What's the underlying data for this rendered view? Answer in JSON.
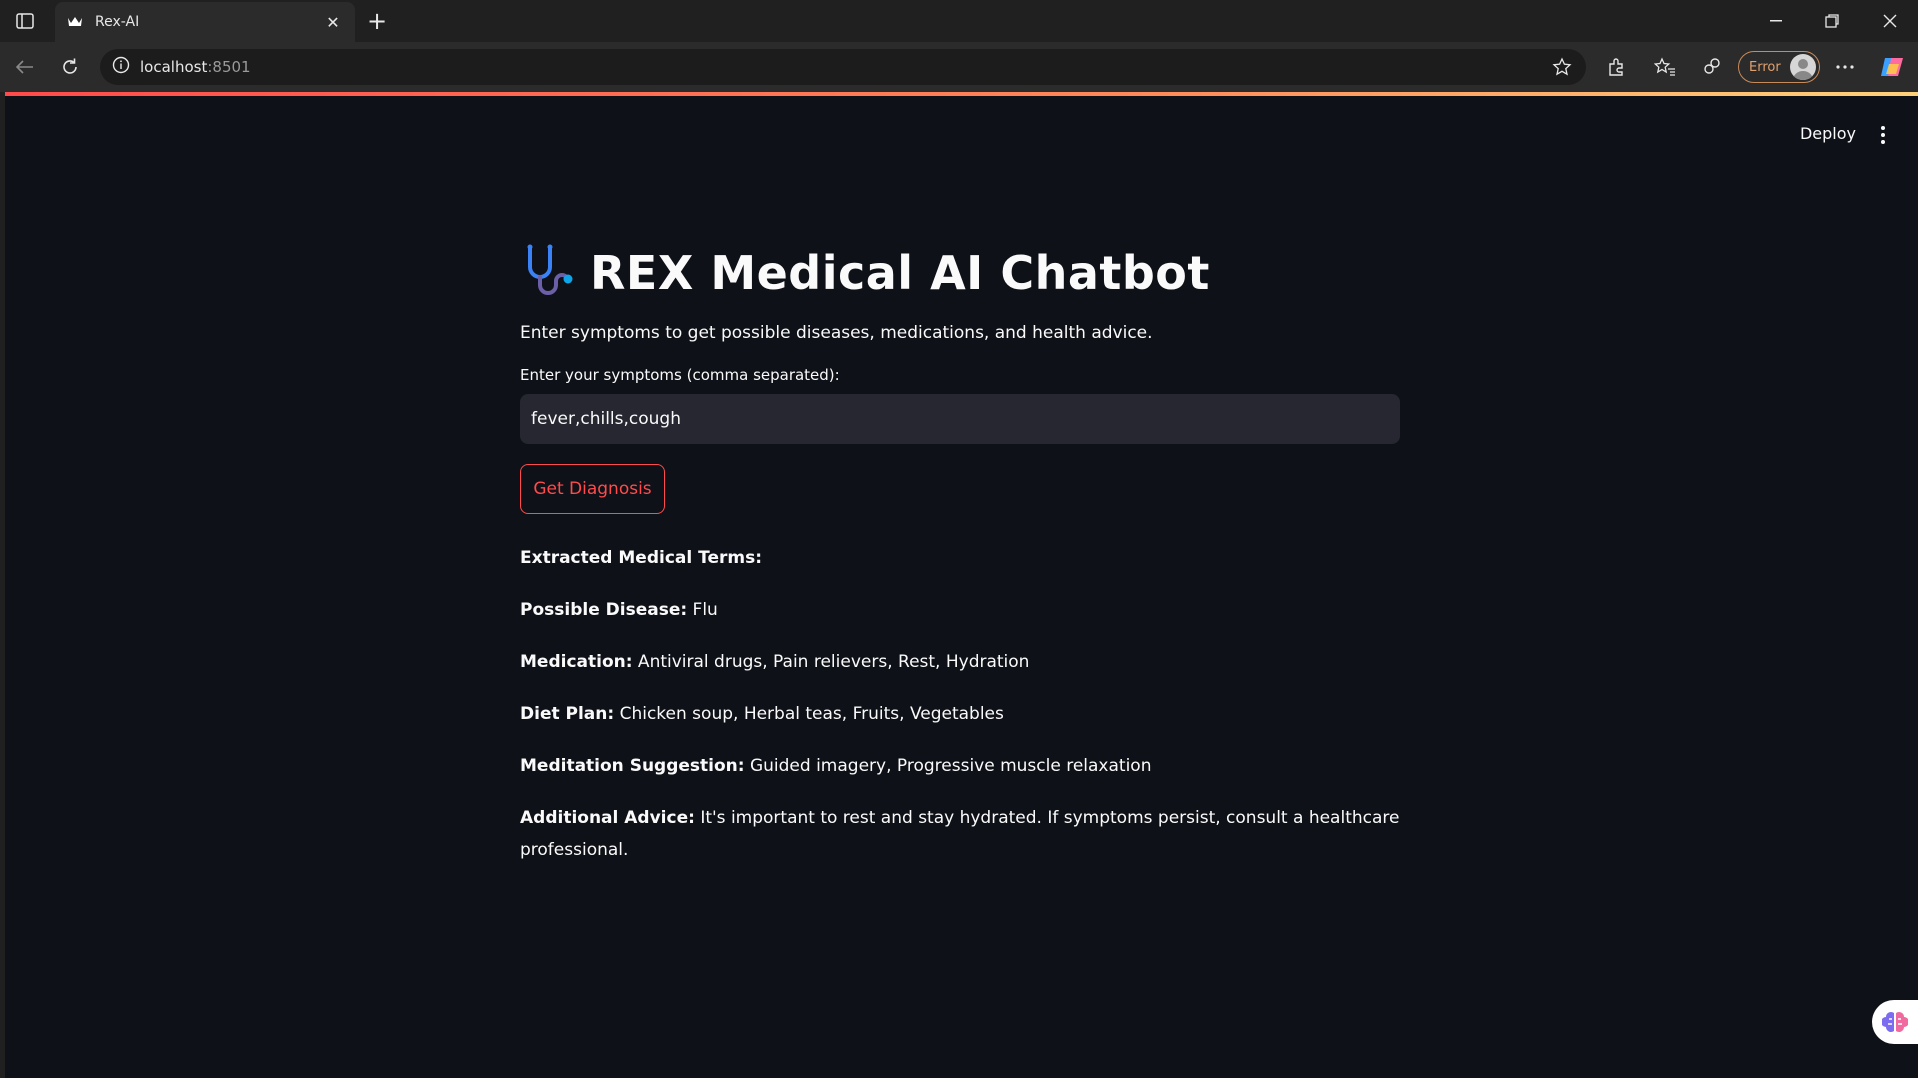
{
  "browser": {
    "tab_title": "Rex-AI",
    "tab_close": "✕",
    "new_tab": "+",
    "url_host": "localhost",
    "url_port": ":8501",
    "profile_label": "Error"
  },
  "app": {
    "deploy_label": "Deploy",
    "title": "REX Medical AI Chatbot",
    "subtitle": "Enter symptoms to get possible diseases, medications, and health advice.",
    "input_label": "Enter your symptoms (comma separated):",
    "input_value": "fever,chills,cough",
    "button_label": "Get Diagnosis",
    "results": {
      "extracted_label": "Extracted Medical Terms:",
      "disease_label": "Possible Disease:",
      "disease_value": " Flu",
      "medication_label": "Medication:",
      "medication_value": " Antiviral drugs, Pain relievers, Rest, Hydration",
      "diet_label": "Diet Plan:",
      "diet_value": " Chicken soup, Herbal teas, Fruits, Vegetables",
      "meditation_label": "Meditation Suggestion:",
      "meditation_value": " Guided imagery, Progressive muscle relaxation",
      "advice_label": "Additional Advice:",
      "advice_value": " It's important to rest and stay hydrated. If symptoms persist, consult a healthcare professional."
    }
  },
  "colors": {
    "app_bg": "#0e1117",
    "accent": "#ff4b4b",
    "input_bg": "#262730"
  },
  "icons": [
    "sidebar-toggle-icon",
    "crown-icon",
    "back-icon",
    "refresh-icon",
    "info-icon",
    "star-icon",
    "extensions-icon",
    "favorites-icon",
    "share-icon",
    "more-icon",
    "copilot-icon",
    "stethoscope-icon",
    "kebab-menu-icon",
    "brain-icon"
  ]
}
